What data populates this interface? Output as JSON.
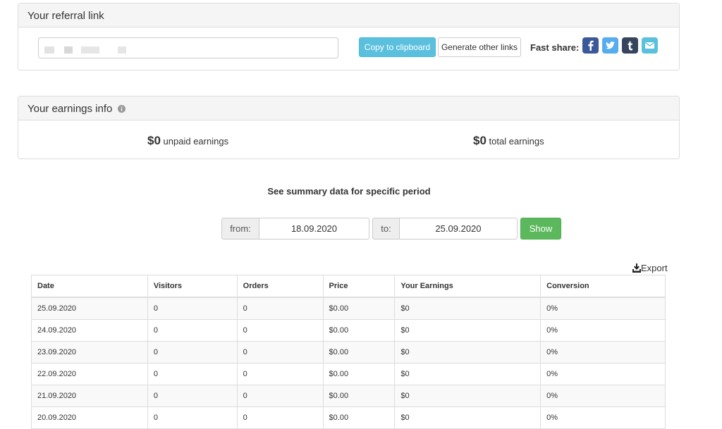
{
  "referral": {
    "title": "Your referral link",
    "link_value": "",
    "copy_label": "Copy to clipboard",
    "generate_label": "Generate other links",
    "fast_share_label": "Fast share:",
    "share_icons": [
      "facebook-icon",
      "twitter-icon",
      "tumblr-icon",
      "email-icon"
    ],
    "share_colors": {
      "facebook": "#3b5998",
      "twitter": "#55acee",
      "tumblr": "#35465c",
      "email": "#5bc0de"
    }
  },
  "earnings": {
    "title": "Your earnings info",
    "unpaid_amount": "$0",
    "unpaid_label": "unpaid earnings",
    "total_amount": "$0",
    "total_label": "total earnings"
  },
  "period": {
    "title": "See summary data for specific period",
    "from_label": "from:",
    "from_value": "18.09.2020",
    "to_label": "to:",
    "to_value": "25.09.2020",
    "show_label": "Show"
  },
  "export_label": "Export",
  "table": {
    "headers": [
      "Date",
      "Visitors",
      "Orders",
      "Price",
      "Your Earnings",
      "Conversion"
    ],
    "rows": [
      [
        "25.09.2020",
        "0",
        "0",
        "$0.00",
        "$0",
        "0%"
      ],
      [
        "24.09.2020",
        "0",
        "0",
        "$0.00",
        "$0",
        "0%"
      ],
      [
        "23.09.2020",
        "0",
        "0",
        "$0.00",
        "$0",
        "0%"
      ],
      [
        "22.09.2020",
        "0",
        "0",
        "$0.00",
        "$0",
        "0%"
      ],
      [
        "21.09.2020",
        "0",
        "0",
        "$0.00",
        "$0",
        "0%"
      ],
      [
        "20.09.2020",
        "0",
        "0",
        "$0.00",
        "$0",
        "0%"
      ]
    ]
  }
}
